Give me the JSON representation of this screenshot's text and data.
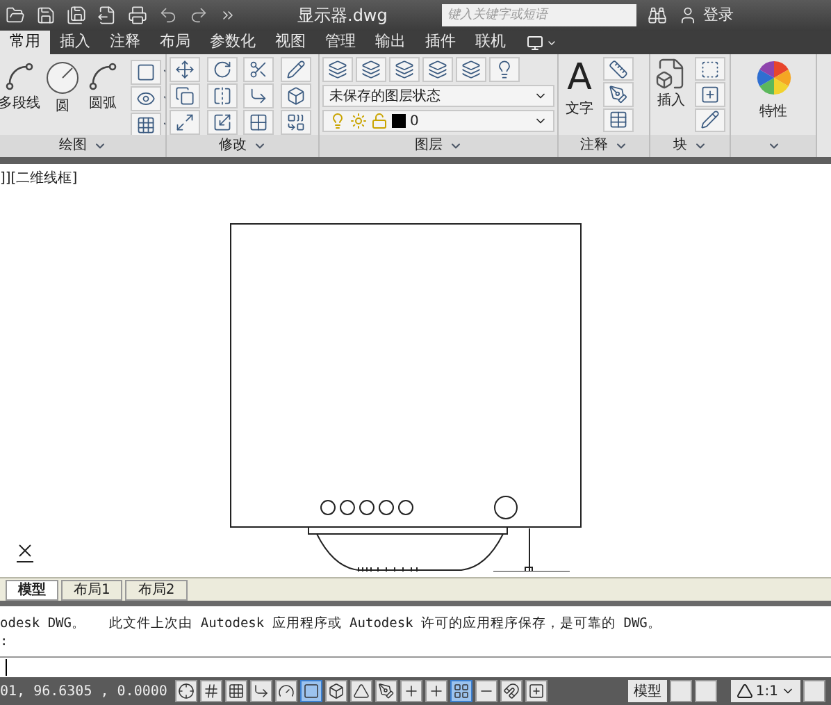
{
  "title_bar": {
    "title": "显示器.dwg",
    "search": {
      "placeholder": "键入关键字或短语"
    },
    "sign_in": "登录"
  },
  "ribbon_tabs": [
    {
      "label": "常用",
      "selected": true
    },
    {
      "label": "插入",
      "selected": false
    },
    {
      "label": "注释",
      "selected": false
    },
    {
      "label": "布局",
      "selected": false
    },
    {
      "label": "参数化",
      "selected": false
    },
    {
      "label": "视图",
      "selected": false
    },
    {
      "label": "管理",
      "selected": false
    },
    {
      "label": "输出",
      "selected": false
    },
    {
      "label": "插件",
      "selected": false
    },
    {
      "label": "联机",
      "selected": false
    }
  ],
  "draw_panel": {
    "title": "绘图",
    "tools": [
      "多段线",
      "圆",
      "圆弧"
    ]
  },
  "modify_panel": {
    "title": "修改"
  },
  "layers_panel": {
    "title": "图层",
    "layer_state": "未保存的图层状态",
    "layer": "0"
  },
  "annotation_panel": {
    "title": "注释",
    "tool": "文字",
    "glyph": "A"
  },
  "block_panel": {
    "title": "块",
    "tool": "插入"
  },
  "properties_panel": {
    "tool": "特性"
  },
  "viewport_label": "]][二维线框]",
  "layout_tabs": [
    {
      "label": "模型",
      "selected": true
    },
    {
      "label": "布局1",
      "selected": false
    },
    {
      "label": "布局2",
      "selected": false
    }
  ],
  "command_lines": [
    "odesk DWG。   此文件上次由 Autodesk 应用程序或 Autodesk 许可的应用程序保存，是可靠的 DWG。",
    ":"
  ],
  "status_bar": {
    "coordinates": "01, 96.6305 , 0.0000",
    "toggles": [
      {
        "on": false
      },
      {
        "on": false
      },
      {
        "on": false
      },
      {
        "on": false
      },
      {
        "on": false
      },
      {
        "on": true
      },
      {
        "on": false
      },
      {
        "on": false
      },
      {
        "on": false
      },
      {
        "on": false
      },
      {
        "on": false
      },
      {
        "on": true
      },
      {
        "on": false
      },
      {
        "on": false
      },
      {
        "on": false
      }
    ],
    "model": "模型",
    "scale": "1:1"
  }
}
